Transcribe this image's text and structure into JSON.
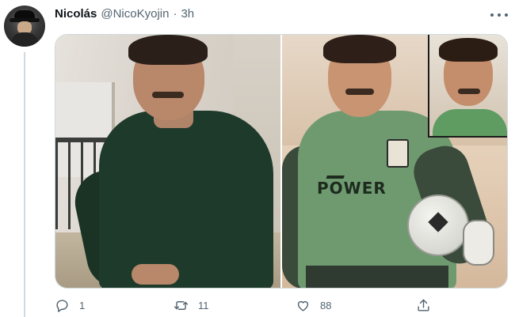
{
  "tweet": {
    "author_name": "Nicolás",
    "handle": "@NicoKyojin",
    "separator": "·",
    "time": "3h",
    "media": {
      "right_photo_text": "POWER"
    },
    "actions": {
      "reply_count": "1",
      "retweet_count": "11",
      "like_count": "88"
    }
  },
  "colors": {
    "secondary_text": "#536471",
    "border": "#cfd9de",
    "primary_text": "#0f1419"
  },
  "icons": [
    "more-icon",
    "reply-icon",
    "retweet-icon",
    "like-icon",
    "share-icon"
  ]
}
